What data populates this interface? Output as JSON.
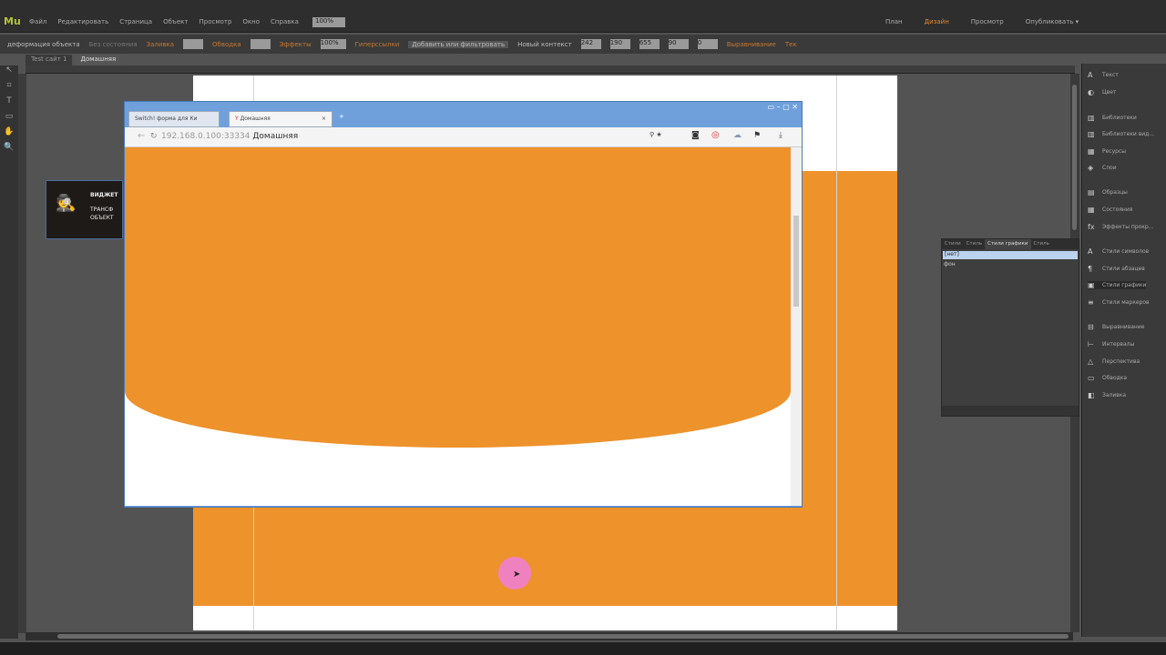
{
  "app": {
    "logo": "Mu",
    "menu": [
      "Файл",
      "Редактировать",
      "Страница",
      "Объект",
      "Просмотр",
      "Окно",
      "Справка"
    ],
    "zoom": "100%",
    "modes": [
      "План",
      "Дизайн",
      "Просмотр"
    ],
    "active_mode": "Дизайн",
    "publish": "Опубликовать ▾"
  },
  "toolbar": {
    "state": "деформация объекта",
    "states_dd": "Без состояния",
    "fill": "Заливка",
    "stroke": "Обводка",
    "effects": "Эффекты",
    "opacity": "100%",
    "hyperlinks": "Гиперссылки",
    "link_dd": "Добавить или фильтровать",
    "new_window": "Новый контекст",
    "x": "242",
    "y": "190",
    "w": "655",
    "h": "90",
    "angle": "0",
    "wrap": "Выравнивание",
    "text": "Тек"
  },
  "tabs": [
    "Test сайт 1",
    "Домашняя"
  ],
  "widget": {
    "lines": [
      "ВИДЖЕТ",
      "ТРАНСФ",
      "ОБЪЕКТ"
    ]
  },
  "browser": {
    "tabs": [
      "Switch! форма для Ки",
      "Домашняя"
    ],
    "url_host": "192.168.0.100:33334",
    "url_title": "Домашняя",
    "brand_color": "#ee922b"
  },
  "right_panel": {
    "items": [
      "Текст",
      "Цвет",
      "Библиотеки",
      "Библиотеки вид...",
      "Ресурсы",
      "Слои",
      "Образцы",
      "Состояния",
      "Эффекты прокр...",
      "Стили символов",
      "Стили абзацев",
      "Стили графики",
      "Стили маркеров",
      "Выравнивание",
      "Интервалы",
      "Перспектива",
      "Обводка",
      "Заливка"
    ],
    "selected": "Стили графики"
  },
  "styles_panel": {
    "tabs": [
      "Стили",
      "Стиль",
      "Стили графики",
      "Стиль"
    ],
    "rows": [
      "[нет]",
      "фон"
    ]
  }
}
